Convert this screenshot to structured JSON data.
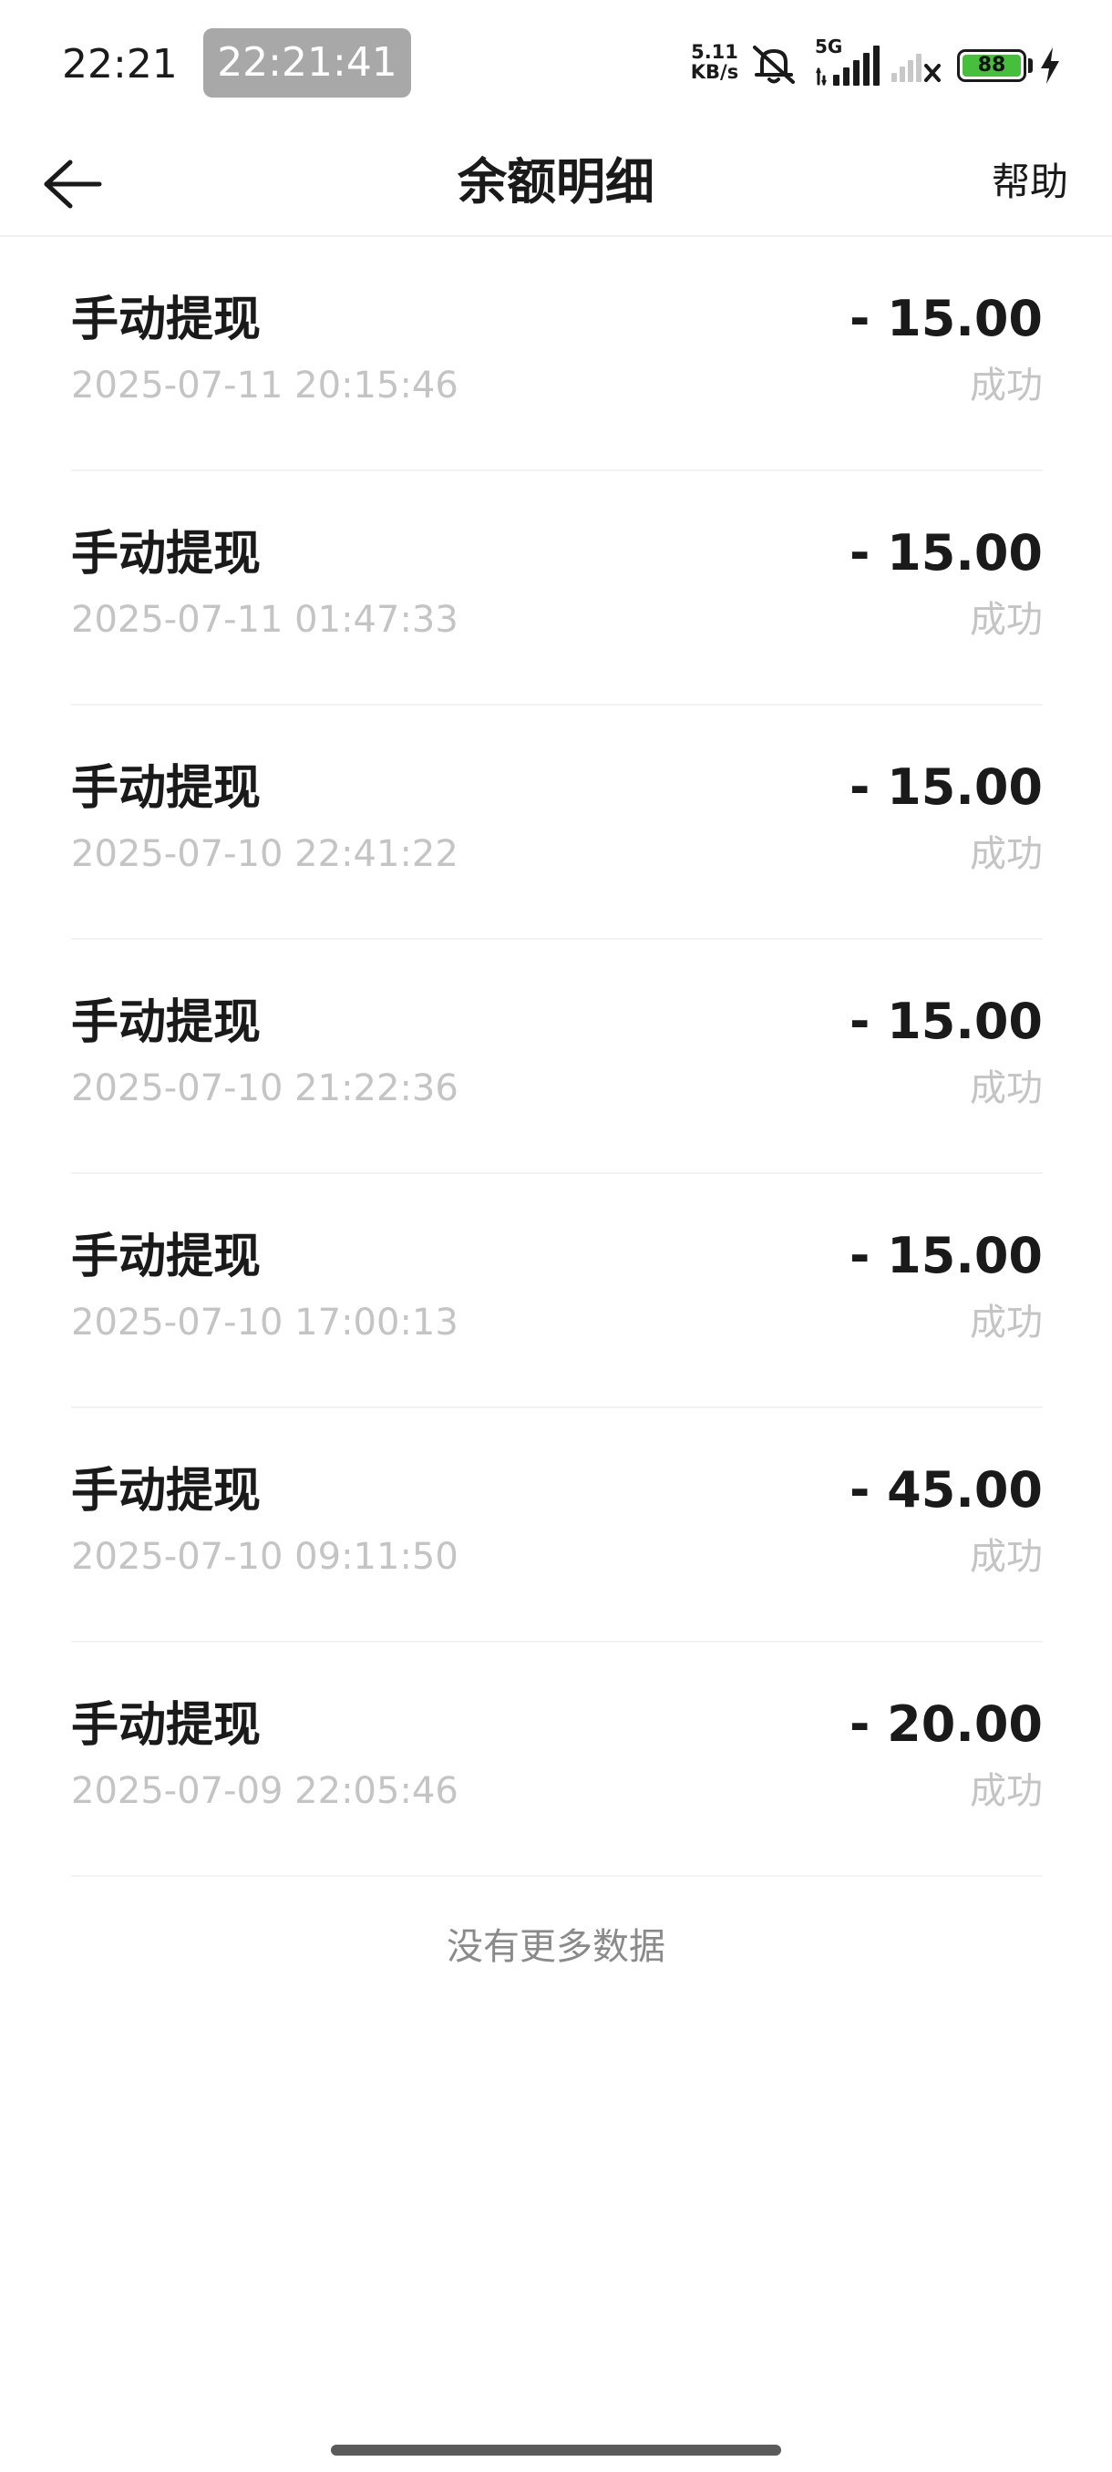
{
  "status_bar": {
    "time": "22:21",
    "clock_pill": "22:21:41",
    "net_speed_value": "5.11",
    "net_speed_unit": "KB/s",
    "network_label": "5G",
    "battery_level": "88",
    "battery_color": "#46c03c"
  },
  "header": {
    "title": "余额明细",
    "help_label": "帮助"
  },
  "transactions": [
    {
      "type": "手动提现",
      "amount": "- 15.00",
      "time": "2025-07-11 20:15:46",
      "status": "成功"
    },
    {
      "type": "手动提现",
      "amount": "- 15.00",
      "time": "2025-07-11 01:47:33",
      "status": "成功"
    },
    {
      "type": "手动提现",
      "amount": "- 15.00",
      "time": "2025-07-10 22:41:22",
      "status": "成功"
    },
    {
      "type": "手动提现",
      "amount": "- 15.00",
      "time": "2025-07-10 21:22:36",
      "status": "成功"
    },
    {
      "type": "手动提现",
      "amount": "- 15.00",
      "time": "2025-07-10 17:00:13",
      "status": "成功"
    },
    {
      "type": "手动提现",
      "amount": "- 45.00",
      "time": "2025-07-10 09:11:50",
      "status": "成功"
    },
    {
      "type": "手动提现",
      "amount": "- 20.00",
      "time": "2025-07-09 22:05:46",
      "status": "成功"
    }
  ],
  "footer": {
    "no_more_text": "没有更多数据"
  }
}
